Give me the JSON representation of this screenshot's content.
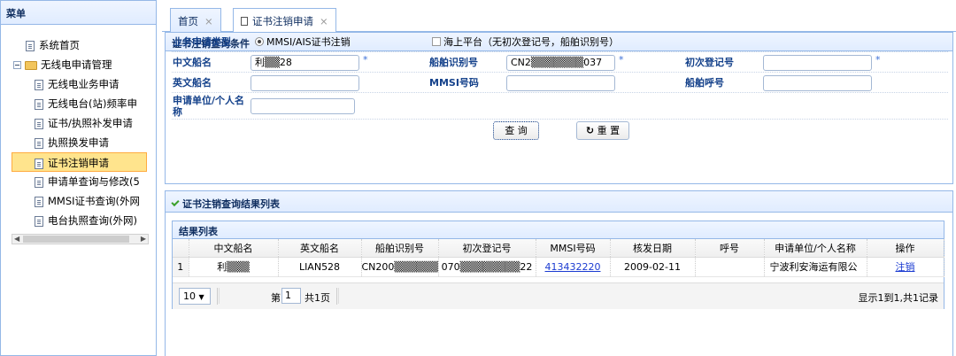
{
  "menu": {
    "title": "菜单",
    "items": [
      {
        "label": "系统首页"
      },
      {
        "label": "无线电申请管理"
      },
      {
        "label": "无线电业务申请"
      },
      {
        "label": "无线电台(站)频率申"
      },
      {
        "label": "证书/执照补发申请"
      },
      {
        "label": "执照换发申请"
      },
      {
        "label": "证书注销申请"
      },
      {
        "label": "申请单查询与修改(5"
      },
      {
        "label": "MMSI证书查询(外网"
      },
      {
        "label": "电台执照查询(外网)"
      }
    ]
  },
  "tabs": [
    {
      "label": "首页",
      "close": "×"
    },
    {
      "label": "证书注销申请",
      "close": "×"
    }
  ],
  "query_panel": {
    "title": "证书注销查询条件",
    "apply_type_label": "业务申请类型",
    "option_mmsi": "MMSI/AIS证书注销",
    "option_platform": "海上平台（无初次登记号，船舶识别号）",
    "cn_name_label": "中文船名",
    "cn_name_value": "利▒▒28",
    "ship_id_label": "船舶识别号",
    "ship_id_value": "CN2▒▒▒▒▒▒▒037",
    "first_reg_label": "初次登记号",
    "first_reg_value": "",
    "en_name_label": "英文船名",
    "en_name_value": "",
    "mmsi_label": "MMSI号码",
    "mmsi_value": "",
    "callsign_label": "船舶呼号",
    "callsign_value": "",
    "applicant_label": "申请单位/个人名称",
    "applicant_value": "",
    "required_mark": "*",
    "search_label": "查 询",
    "reset_label": "重 置",
    "reset_icon": "↻"
  },
  "result_panel": {
    "title": "证书注销查询结果列表",
    "list_title": "结果列表",
    "columns": [
      "",
      "中文船名",
      "英文船名",
      "船舶识别号",
      "初次登记号",
      "MMSI号码",
      "核发日期",
      "呼号",
      "申请单位/个人名称",
      "操作"
    ],
    "rows": [
      {
        "num": "1",
        "cn_name": "利▒▒▒",
        "en_name": "LIAN528",
        "ship_id": "CN200▒▒▒▒▒▒▒▒▒",
        "first_reg": "070▒▒▒▒▒▒▒▒22",
        "mmsi": "413432220",
        "issue_date": "2009-02-11",
        "callsign": "",
        "applicant": "宁波利安海运有限公",
        "action": "注销"
      }
    ]
  },
  "pager": {
    "page_size": "10",
    "page_prefix": "第",
    "page_value": "1",
    "page_suffix": "共1页",
    "info": "显示1到1,共1记录"
  }
}
